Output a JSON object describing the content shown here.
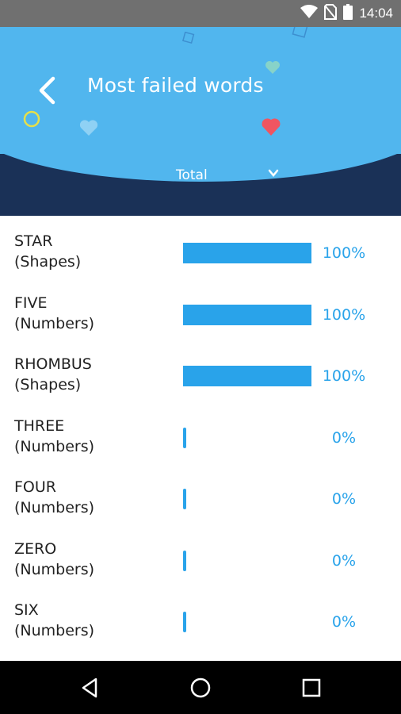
{
  "status_bar": {
    "time": "14:04",
    "icons": [
      "wifi-icon",
      "no-sim-icon",
      "battery-icon"
    ]
  },
  "header": {
    "title": "Most failed words",
    "back_icon": "chevron-left-icon",
    "filter": {
      "selected": "Total",
      "icon": "chevron-down-icon"
    }
  },
  "colors": {
    "header_top": "#51b6ee",
    "header_bottom": "#1a3157",
    "bar": "#29a3ea"
  },
  "words": [
    {
      "word": "STAR",
      "category": "(Shapes)",
      "percent_label": "100%",
      "fraction": 1.0
    },
    {
      "word": "FIVE",
      "category": "(Numbers)",
      "percent_label": "100%",
      "fraction": 1.0
    },
    {
      "word": "RHOMBUS",
      "category": "(Shapes)",
      "percent_label": "100%",
      "fraction": 1.0
    },
    {
      "word": "THREE",
      "category": "(Numbers)",
      "percent_label": "0%",
      "fraction": 0
    },
    {
      "word": "FOUR",
      "category": "(Numbers)",
      "percent_label": "0%",
      "fraction": 0
    },
    {
      "word": "ZERO",
      "category": "(Numbers)",
      "percent_label": "0%",
      "fraction": 0
    },
    {
      "word": "SIX",
      "category": "(Numbers)",
      "percent_label": "0%",
      "fraction": 0
    }
  ],
  "nav_bar": {
    "icons": [
      "back-triangle-icon",
      "home-circle-icon",
      "recents-square-icon"
    ]
  }
}
